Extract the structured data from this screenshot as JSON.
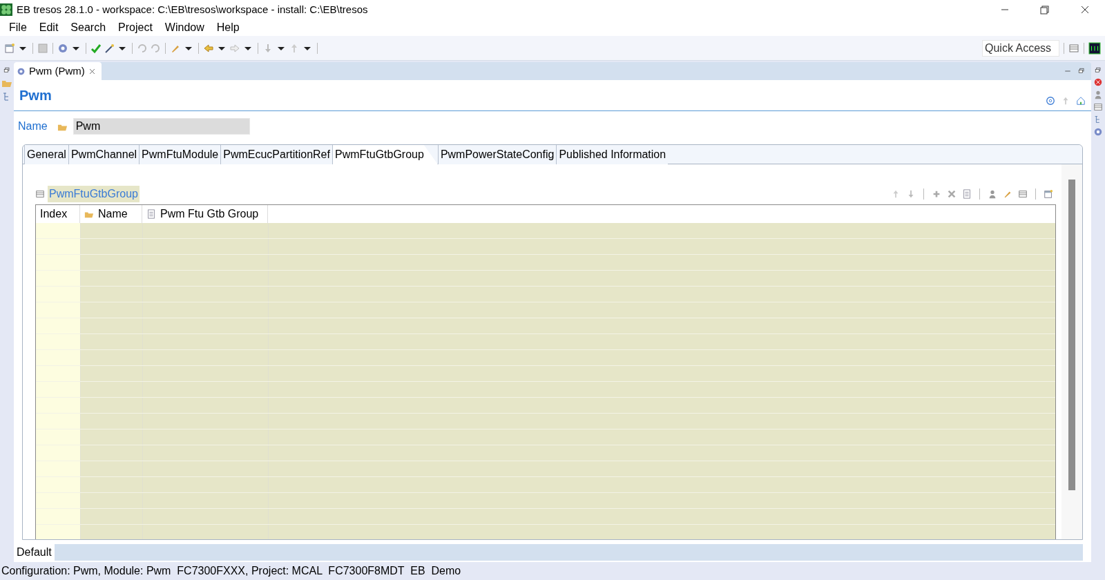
{
  "window": {
    "title": "EB tresos 28.1.0 - workspace: C:\\EB\\tresos\\workspace - install: C:\\EB\\tresos"
  },
  "menu": [
    "File",
    "Edit",
    "Search",
    "Project",
    "Window",
    "Help"
  ],
  "quick_access": {
    "placeholder": "Quick Access"
  },
  "editor_tab": {
    "label": "Pwm (Pwm)",
    "selected": true
  },
  "header": {
    "title": "Pwm"
  },
  "name_field": {
    "label": "Name",
    "value": "Pwm"
  },
  "tabs": [
    {
      "label": "General",
      "selected": false
    },
    {
      "label": "PwmChannel",
      "selected": false
    },
    {
      "label": "PwmFtuModule",
      "selected": false
    },
    {
      "label": "PwmEcucPartitionRef",
      "selected": false
    },
    {
      "label": "PwmFtuGtbGroup",
      "selected": true
    },
    {
      "label": "PwmPowerStateConfig",
      "selected": false
    },
    {
      "label": "Published Information",
      "selected": false
    }
  ],
  "section": {
    "title": "PwmFtuGtbGroup"
  },
  "table": {
    "columns": [
      {
        "label": "Index",
        "kind": "plain"
      },
      {
        "label": "Name",
        "kind": "folder"
      },
      {
        "label": "Pwm Ftu Gtb Group",
        "kind": "document"
      }
    ]
  },
  "bottom_tab": {
    "label": "Default"
  },
  "status_bar": "Configuration: Pwm, Module: Pwm  FC7300FXXX, Project: MCAL  FC7300F8MDT  EB  Demo"
}
